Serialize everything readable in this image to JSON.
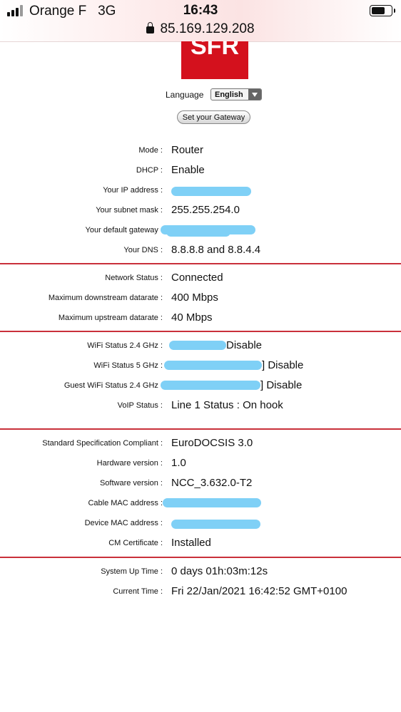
{
  "status_bar": {
    "carrier": "Orange F",
    "network": "3G",
    "time": "16:43",
    "url": "85.169.129.208"
  },
  "brand": {
    "logo_text": "SFR",
    "color": "#d4111d"
  },
  "language": {
    "label": "Language",
    "selected": "English"
  },
  "gateway_button": "Set your Gateway",
  "sections": [
    [
      {
        "label": "Mode :",
        "value": "Router"
      },
      {
        "label": "DHCP :",
        "value": "Enable"
      },
      {
        "label": "Your IP address :",
        "value": ""
      },
      {
        "label": "Your subnet mask :",
        "value": "255.255.254.0"
      },
      {
        "label": "Your default gateway :",
        "value": ""
      },
      {
        "label": "Your DNS :",
        "value": "8.8.8.8 and 8.8.4.4"
      }
    ],
    [
      {
        "label": "Network Status :",
        "value": "Connected"
      },
      {
        "label": "Maximum downstream datarate :",
        "value": "400 Mbps"
      },
      {
        "label": "Maximum upstream datarate :",
        "value": "40 Mbps"
      }
    ],
    [
      {
        "label": "WiFi Status 2.4 GHz :",
        "value": "Disable"
      },
      {
        "label": "WiFi Status 5 GHz :",
        "value": "] Disable"
      },
      {
        "label": "Guest WiFi Status 2.4 GHz :",
        "value": "] Disable"
      },
      {
        "label": "VoIP Status :",
        "value": "Line 1 Status : On hook"
      }
    ],
    [
      {
        "label": "Standard Specification Compliant :",
        "value": "EuroDOCSIS 3.0"
      },
      {
        "label": "Hardware version :",
        "value": "1.0"
      },
      {
        "label": "Software version :",
        "value": "NCC_3.632.0-T2"
      },
      {
        "label": "Cable MAC address :",
        "value": ""
      },
      {
        "label": "Device MAC address :",
        "value": ""
      },
      {
        "label": "CM Certificate :",
        "value": "Installed"
      }
    ],
    [
      {
        "label": "System Up Time :",
        "value": "0 days 01h:03m:12s"
      },
      {
        "label": "Current Time :",
        "value": "Fri 22/Jan/2021 16:42:52 GMT+0100"
      }
    ]
  ],
  "colors": {
    "separator": "#c9303a",
    "redaction": "#7fd0f6"
  }
}
